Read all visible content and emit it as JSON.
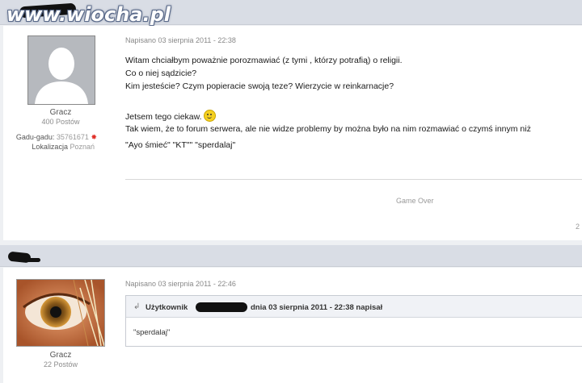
{
  "watermark": "www.wiocha.pl",
  "post1": {
    "date": "Napisano 03 sierpnia 2011 - 22:38",
    "author": "Gracz",
    "post_count": "400 Postów",
    "gadu_label": "Gadu-gadu:",
    "gadu_value": "35761671",
    "location_label": "Lokalizacja",
    "location_value": "Poznań",
    "lines": [
      "Witam chciałbym poważnie porozmawiać (z tymi , którzy potrafią) o religii.",
      "Co o niej sądzicie?",
      "Kim jesteście? Czym popieracie swoją teze? Wierzycie w reinkarnacje?",
      "Jetsem tego ciekaw.",
      "Tak wiem, że to forum serwera, ale nie widze problemy by można było na nim rozmawiać o czymś innym niż",
      "\"Ayo śmieć\" \"KT\"\" \"sperdalaj\""
    ],
    "signature": "Game Over",
    "edge_mark": "2"
  },
  "post2": {
    "date": "Napisano 03 sierpnia 2011 - 22:46",
    "author": "Gracz",
    "post_count": "22 Postów",
    "quote_user_label": "Użytkownik",
    "quote_meta": "dnia 03 sierpnia 2011 - 22:38 napisał",
    "quote_text": "\"sperdalaj\""
  },
  "colors": {
    "header_bar": "#d9dde5",
    "page_bg": "#eef0f3",
    "status_dot": "#e0302a"
  },
  "icons": [
    "user-silhouette-icon",
    "online-status-icon",
    "smiley-icon",
    "quote-arrow-icon"
  ]
}
